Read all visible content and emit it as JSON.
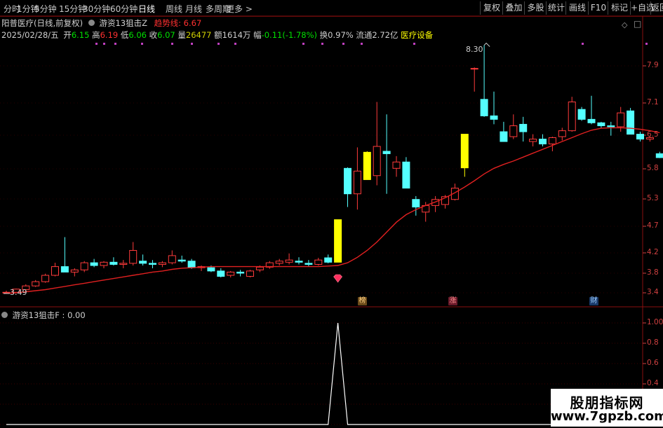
{
  "toolbar": {
    "periods": [
      "分时",
      "1分钟",
      "5分钟",
      "15分钟",
      "30分钟",
      "60分钟",
      "日线",
      "周线",
      "月线",
      "多周期",
      "更多 >"
    ],
    "active_period": "日线",
    "right_buttons": [
      "复权",
      "叠加",
      "多股",
      "统计",
      "画线",
      "F10",
      "标记",
      "+自选",
      "返回"
    ]
  },
  "header": {
    "stock": "阳普医疗(日线,前复权)",
    "indicator": "游资13狙击Z",
    "trend_label": "趋势线: 6.67",
    "date": "2025/02/28/五",
    "open_label": "开",
    "open": "6.15",
    "high_label": "高",
    "high": "6.19",
    "low_label": "低",
    "low": "6.06",
    "close_label": "收",
    "close": "6.07",
    "vol_label": "量",
    "vol": "26477",
    "amt_label": "额",
    "amt": "1614万",
    "chg_label": "幅",
    "chg": "-0.11(-1.78%)",
    "turnover_label": "换",
    "turnover": "0.97%",
    "float_label": "流通",
    "float": "2.72亿",
    "sector": "医疗设备"
  },
  "sub_header": {
    "label": "游资13狙击F : 0.00"
  },
  "markers": {
    "bang": "榜",
    "zhang": "涨",
    "cai": "财"
  },
  "watermark": {
    "title": "股朋指标网",
    "url": "www.7gpzb.com"
  },
  "colors": {
    "up": "#ff3b3b",
    "down": "#54ffff",
    "signal": "#ffff00",
    "trend": "#e02020",
    "axis": "#d04040"
  },
  "chart_data": {
    "type": "candlestick",
    "price_axis_ticks": [
      7.9,
      7.18,
      6.53,
      5.84,
      5.31,
      4.77,
      4.23,
      3.86,
      3.49
    ],
    "price_axis_labels": [
      "7.9",
      "7.1",
      "6.5",
      "5.8",
      "5.3",
      "4.7",
      "4.2",
      "3.8",
      "3.4"
    ],
    "sub_axis_ticks": [
      1.0,
      0.8,
      0.6,
      0.4,
      0.2,
      0.0
    ],
    "sub_axis_labels": [
      "1.00",
      "0.8",
      "0.6",
      "0.4",
      "0.2",
      "0.0"
    ],
    "annotations": {
      "high": "8.30",
      "low": "3.49"
    },
    "candles": [
      [
        3.49,
        3.53,
        3.47,
        3.5,
        0
      ],
      [
        3.5,
        3.57,
        3.49,
        3.56,
        0
      ],
      [
        3.55,
        3.65,
        3.53,
        3.62,
        0
      ],
      [
        3.62,
        3.73,
        3.6,
        3.7,
        0
      ],
      [
        3.7,
        3.85,
        3.68,
        3.82,
        0
      ],
      [
        3.82,
        4.05,
        3.8,
        3.98,
        0
      ],
      [
        3.98,
        4.55,
        3.9,
        3.88,
        0
      ],
      [
        3.88,
        3.95,
        3.8,
        3.92,
        0
      ],
      [
        3.92,
        4.08,
        3.88,
        4.05,
        0
      ],
      [
        4.05,
        4.12,
        3.97,
        4.0,
        0
      ],
      [
        4.0,
        4.08,
        3.95,
        4.06,
        0
      ],
      [
        4.06,
        4.15,
        4.0,
        4.02,
        0
      ],
      [
        4.02,
        4.1,
        3.95,
        4.04,
        0
      ],
      [
        4.04,
        4.45,
        4.0,
        4.28,
        0
      ],
      [
        4.08,
        4.2,
        4.0,
        4.04,
        0
      ],
      [
        4.04,
        4.1,
        3.95,
        4.02,
        0
      ],
      [
        4.02,
        4.08,
        3.97,
        4.05,
        0
      ],
      [
        4.05,
        4.28,
        4.02,
        4.18,
        0
      ],
      [
        4.1,
        4.18,
        4.05,
        4.08,
        0
      ],
      [
        4.08,
        4.12,
        3.94,
        3.96,
        0
      ],
      [
        3.96,
        4.0,
        3.9,
        3.98,
        0
      ],
      [
        3.96,
        4.0,
        3.88,
        3.9,
        0
      ],
      [
        3.9,
        3.95,
        3.78,
        3.8,
        0
      ],
      [
        3.82,
        3.9,
        3.78,
        3.88,
        0
      ],
      [
        3.88,
        3.92,
        3.8,
        3.86,
        0
      ],
      [
        3.8,
        3.92,
        3.78,
        3.9,
        0
      ],
      [
        3.92,
        4.0,
        3.88,
        3.97,
        0
      ],
      [
        3.97,
        4.08,
        3.94,
        4.05,
        0
      ],
      [
        4.04,
        4.12,
        4.0,
        4.08,
        0
      ],
      [
        4.06,
        4.22,
        4.02,
        4.1,
        0
      ],
      [
        4.08,
        4.15,
        4.02,
        4.06,
        0
      ],
      [
        4.04,
        4.1,
        3.98,
        4.02,
        0
      ],
      [
        4.02,
        4.14,
        4.0,
        4.1,
        0
      ],
      [
        4.14,
        4.2,
        4.04,
        4.06,
        0
      ],
      [
        4.06,
        4.9,
        4.06,
        4.9,
        1
      ],
      [
        5.85,
        5.87,
        5.15,
        5.4,
        0
      ],
      [
        5.4,
        6.28,
        5.1,
        5.8,
        0
      ],
      [
        5.65,
        6.2,
        5.65,
        6.18,
        1
      ],
      [
        5.72,
        7.2,
        5.55,
        6.3,
        0
      ],
      [
        6.2,
        6.95,
        5.4,
        6.15,
        0
      ],
      [
        5.85,
        6.1,
        5.7,
        5.98,
        0
      ],
      [
        5.98,
        6.08,
        5.5,
        5.5,
        0
      ],
      [
        5.3,
        5.36,
        4.98,
        5.15,
        0
      ],
      [
        5.05,
        5.25,
        4.86,
        5.18,
        0
      ],
      [
        5.18,
        5.36,
        5.05,
        5.3,
        0
      ],
      [
        5.2,
        5.38,
        5.12,
        5.35,
        0
      ],
      [
        5.3,
        5.58,
        5.28,
        5.5,
        0
      ],
      [
        5.86,
        6.55,
        5.7,
        6.55,
        1
      ],
      [
        7.85,
        7.87,
        7.4,
        7.85,
        0
      ],
      [
        7.25,
        8.3,
        6.9,
        6.92,
        0
      ],
      [
        6.92,
        7.4,
        6.75,
        6.85,
        0
      ],
      [
        6.6,
        6.8,
        6.4,
        6.4,
        0
      ],
      [
        6.5,
        6.95,
        6.45,
        6.72,
        0
      ],
      [
        6.75,
        6.9,
        6.4,
        6.6,
        0
      ],
      [
        6.4,
        6.55,
        6.3,
        6.45,
        0
      ],
      [
        6.45,
        6.55,
        6.3,
        6.35,
        0
      ],
      [
        6.35,
        6.5,
        6.2,
        6.48,
        0
      ],
      [
        6.5,
        6.68,
        6.42,
        6.62,
        0
      ],
      [
        6.62,
        7.3,
        6.6,
        7.2,
        0
      ],
      [
        7.05,
        7.1,
        6.82,
        6.85,
        0
      ],
      [
        6.85,
        7.32,
        6.75,
        6.78,
        0
      ],
      [
        6.78,
        6.8,
        6.68,
        6.72,
        0
      ],
      [
        6.72,
        6.8,
        6.52,
        6.7,
        0
      ],
      [
        6.7,
        7.1,
        6.6,
        6.98,
        0
      ],
      [
        7.02,
        7.08,
        6.55,
        6.55,
        0
      ],
      [
        6.55,
        6.6,
        6.4,
        6.45,
        0
      ],
      [
        6.45,
        6.52,
        6.4,
        6.48,
        0
      ],
      [
        6.15,
        6.19,
        6.06,
        6.07,
        0
      ]
    ],
    "trend_line": [
      3.48,
      3.49,
      3.51,
      3.53,
      3.55,
      3.58,
      3.61,
      3.64,
      3.67,
      3.7,
      3.73,
      3.76,
      3.79,
      3.82,
      3.85,
      3.88,
      3.9,
      3.93,
      3.95,
      3.96,
      3.97,
      3.98,
      3.98,
      3.98,
      3.98,
      3.98,
      3.98,
      3.98,
      3.98,
      3.98,
      3.98,
      3.98,
      3.98,
      3.99,
      4.0,
      4.05,
      4.15,
      4.28,
      4.45,
      4.65,
      4.85,
      5.0,
      5.1,
      5.18,
      5.25,
      5.33,
      5.42,
      5.52,
      5.63,
      5.75,
      5.85,
      5.93,
      6.0,
      6.08,
      6.16,
      6.24,
      6.32,
      6.4,
      6.48,
      6.56,
      6.63,
      6.67,
      6.68,
      6.68,
      6.67,
      6.65,
      6.62,
      6.58
    ],
    "signal_series": [
      0,
      0,
      0,
      0,
      0,
      0,
      0,
      0,
      0,
      0,
      0,
      0,
      0,
      0,
      0,
      0,
      0,
      0,
      0,
      0,
      0,
      0,
      0,
      0,
      0,
      0,
      0,
      0,
      0,
      0,
      0,
      0,
      0,
      0,
      1,
      0,
      0,
      0,
      0,
      0,
      0,
      0,
      0,
      0,
      0,
      0,
      0,
      0,
      0,
      0,
      0,
      0,
      0,
      0,
      0,
      0,
      0,
      0,
      0,
      0,
      0,
      0,
      0,
      0,
      0,
      0,
      0,
      0
    ]
  }
}
